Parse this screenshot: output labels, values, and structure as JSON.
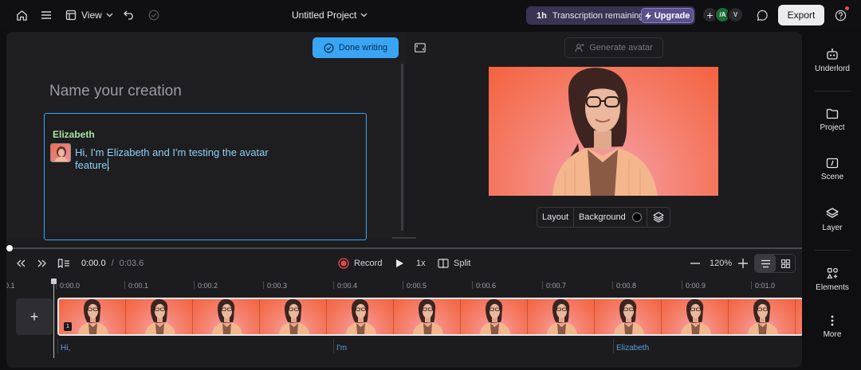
{
  "topbar": {
    "view_label": "View",
    "project_title": "Untitled Project",
    "transcription_hours": "1h",
    "transcription_label": "Transcription remaining",
    "upgrade_label": "Upgrade",
    "collaborators": [
      "/A",
      "V"
    ],
    "export_label": "Export",
    "accent_color": "#5b4f8e"
  },
  "script": {
    "done_label": "Done writing",
    "name_placeholder": "Name your creation",
    "speaker": "Elizabeth",
    "line": "Hi, I'm Elizabeth and I'm testing the avatar feature."
  },
  "preview": {
    "generate_label": "Generate avatar",
    "layout_label": "Layout",
    "background_label": "Background"
  },
  "timeline": {
    "current_time": "0:00.0",
    "separator": "/",
    "duration": "0:03.6",
    "record_label": "Record",
    "speed_label": "1x",
    "split_label": "Split",
    "zoom_label": "120%",
    "ruler": [
      "0.1",
      "0:00.0",
      "0:00.1",
      "0:00.2",
      "0:00.3",
      "0:00.4",
      "0:00.5",
      "0:00.6",
      "0:00.7",
      "0:00.8",
      "0:00.9",
      "0:01.0"
    ],
    "clip_badge": "1",
    "captions": [
      "Hi,",
      "I'm",
      "Elizabeth"
    ]
  },
  "rail": {
    "items": [
      "Underlord",
      "Project",
      "Scene",
      "Layer",
      "Elements",
      "More"
    ]
  }
}
